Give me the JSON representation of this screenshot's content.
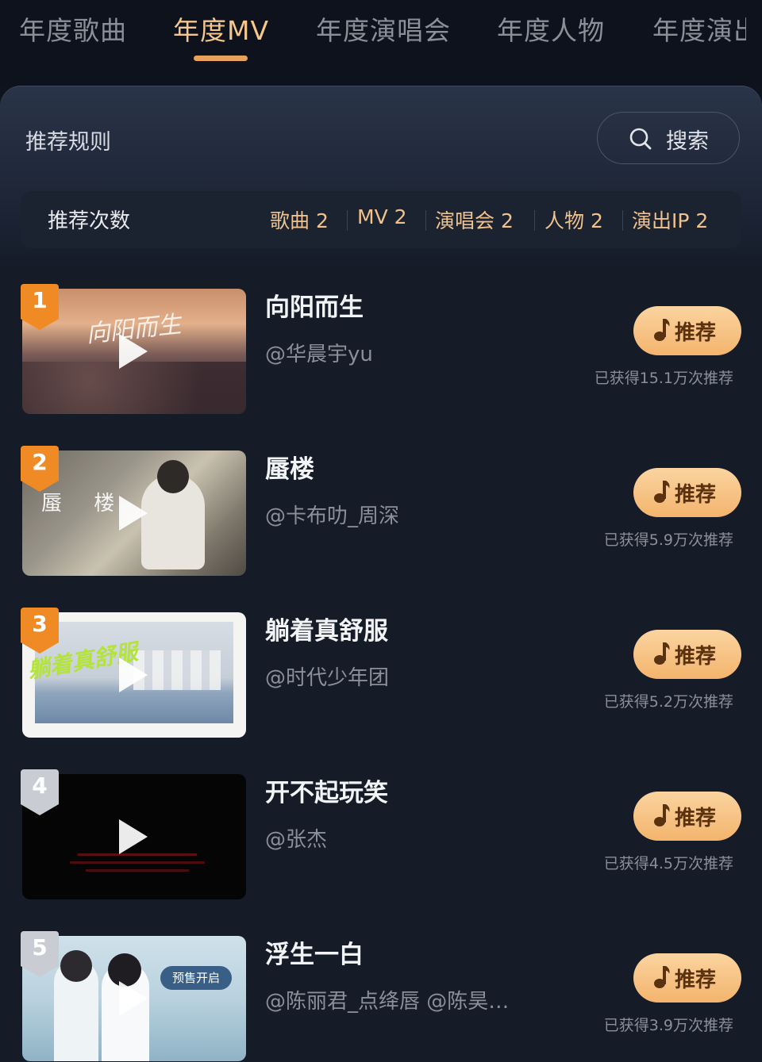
{
  "tabs": [
    {
      "label": "年度歌曲",
      "active": false
    },
    {
      "label": "年度MV",
      "active": true
    },
    {
      "label": "年度演唱会",
      "active": false
    },
    {
      "label": "年度人物",
      "active": false
    },
    {
      "label": "年度演出",
      "active": false
    }
  ],
  "header": {
    "rules_label": "推荐规则",
    "search_label": "搜索"
  },
  "counts": {
    "label": "推荐次数",
    "items": [
      {
        "name": "歌曲",
        "value": "2"
      },
      {
        "name": "MV",
        "value": "2"
      },
      {
        "name": "演唱会",
        "value": "2"
      },
      {
        "name": "人物",
        "value": "2"
      },
      {
        "name": "演出IP",
        "value": "2"
      }
    ]
  },
  "recommend_label": "推荐",
  "items": [
    {
      "rank": "1",
      "title": "向阳而生",
      "artist": "@华晨宇yu",
      "count": "已获得15.1万次推荐",
      "thumb_text": "向阳而生"
    },
    {
      "rank": "2",
      "title": "蜃楼",
      "artist": "@卡布叻_周深",
      "count": "已获得5.9万次推荐",
      "thumb_text": "蜃 楼"
    },
    {
      "rank": "3",
      "title": "躺着真舒服",
      "artist": "@时代少年团",
      "count": "已获得5.2万次推荐",
      "thumb_text": "躺着真舒服"
    },
    {
      "rank": "4",
      "title": "开不起玩笑",
      "artist": "@张杰",
      "count": "已获得4.5万次推荐",
      "thumb_text": ""
    },
    {
      "rank": "5",
      "title": "浮生一白",
      "artist": "@陈丽君_点绛唇 @陈昊…",
      "count": "已获得3.9万次推荐",
      "thumb_text": "预售开启"
    }
  ],
  "colors": {
    "accent": "#f5c78e",
    "button": "#f7c07f",
    "rank_gold": "#f08a24",
    "rank_silver": "#c9ccd3"
  }
}
